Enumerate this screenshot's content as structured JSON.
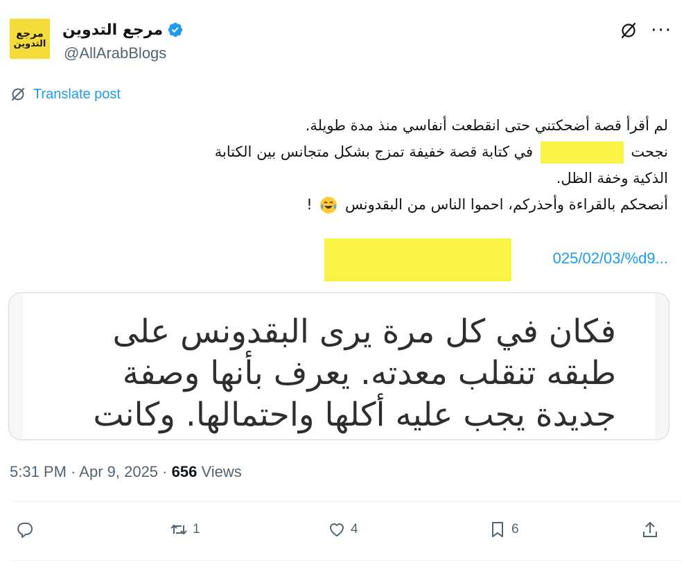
{
  "account": {
    "avatar_text_line1": "مرجع",
    "avatar_text_line2": "التدوين",
    "display_name": "مرجع التدوين",
    "handle": "@AllArabBlogs",
    "verified_color": "#1d9bf0"
  },
  "header": {
    "grok_icon": "grok-icon",
    "more_label": "···"
  },
  "translate": {
    "label": "Translate post",
    "icon": "translate-globe-icon"
  },
  "tweet": {
    "line1": "لم أقرأ قصة أضحكتني حتى انقطعت أنفاسي منذ مدة طويلة.",
    "line2_start": "نجحت",
    "line2_end": "في كتابة قصة خفيفة تمزج بشكل متجانس بين الكتابة",
    "line3": "الذكية وخفة الظل.",
    "line4": "أنصحكم بالقراءة وأحذركم، احموا الناس من البقدونس",
    "line4_end": "!",
    "emoji": "face-with-tears-of-joy",
    "link_text": "025/02/03/%d9..."
  },
  "card": {
    "line1": "فكان في كل مرة يرى البقدونس على",
    "line2": "طبقه تنقلب معدته. يعرف بأنها وصفة",
    "line3": "جديدة يجب عليه أكلها واحتمالها. وكانت"
  },
  "meta": {
    "time": "5:31 PM",
    "separator": "·",
    "date": "Apr 9, 2025",
    "views_count": "656",
    "views_label": "Views"
  },
  "actions": {
    "reply_count": "",
    "retweet_count": "1",
    "like_count": "4",
    "bookmark_count": "6"
  },
  "colors": {
    "accent": "#1d9bf0",
    "redaction": "#faf347",
    "muted": "#536471",
    "text": "#0f1419"
  }
}
